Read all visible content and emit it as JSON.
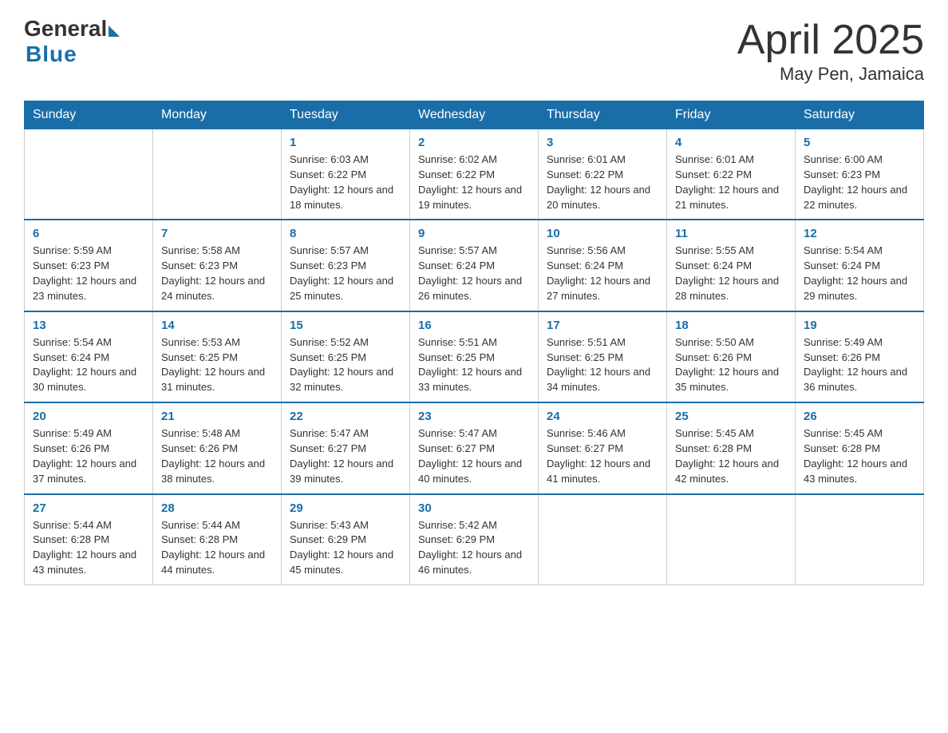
{
  "logo": {
    "general": "General",
    "blue": "Blue"
  },
  "header": {
    "month": "April 2025",
    "location": "May Pen, Jamaica"
  },
  "days_of_week": [
    "Sunday",
    "Monday",
    "Tuesday",
    "Wednesday",
    "Thursday",
    "Friday",
    "Saturday"
  ],
  "weeks": [
    [
      {
        "day": "",
        "sunrise": "",
        "sunset": "",
        "daylight": ""
      },
      {
        "day": "",
        "sunrise": "",
        "sunset": "",
        "daylight": ""
      },
      {
        "day": "1",
        "sunrise": "Sunrise: 6:03 AM",
        "sunset": "Sunset: 6:22 PM",
        "daylight": "Daylight: 12 hours and 18 minutes."
      },
      {
        "day": "2",
        "sunrise": "Sunrise: 6:02 AM",
        "sunset": "Sunset: 6:22 PM",
        "daylight": "Daylight: 12 hours and 19 minutes."
      },
      {
        "day": "3",
        "sunrise": "Sunrise: 6:01 AM",
        "sunset": "Sunset: 6:22 PM",
        "daylight": "Daylight: 12 hours and 20 minutes."
      },
      {
        "day": "4",
        "sunrise": "Sunrise: 6:01 AM",
        "sunset": "Sunset: 6:22 PM",
        "daylight": "Daylight: 12 hours and 21 minutes."
      },
      {
        "day": "5",
        "sunrise": "Sunrise: 6:00 AM",
        "sunset": "Sunset: 6:23 PM",
        "daylight": "Daylight: 12 hours and 22 minutes."
      }
    ],
    [
      {
        "day": "6",
        "sunrise": "Sunrise: 5:59 AM",
        "sunset": "Sunset: 6:23 PM",
        "daylight": "Daylight: 12 hours and 23 minutes."
      },
      {
        "day": "7",
        "sunrise": "Sunrise: 5:58 AM",
        "sunset": "Sunset: 6:23 PM",
        "daylight": "Daylight: 12 hours and 24 minutes."
      },
      {
        "day": "8",
        "sunrise": "Sunrise: 5:57 AM",
        "sunset": "Sunset: 6:23 PM",
        "daylight": "Daylight: 12 hours and 25 minutes."
      },
      {
        "day": "9",
        "sunrise": "Sunrise: 5:57 AM",
        "sunset": "Sunset: 6:24 PM",
        "daylight": "Daylight: 12 hours and 26 minutes."
      },
      {
        "day": "10",
        "sunrise": "Sunrise: 5:56 AM",
        "sunset": "Sunset: 6:24 PM",
        "daylight": "Daylight: 12 hours and 27 minutes."
      },
      {
        "day": "11",
        "sunrise": "Sunrise: 5:55 AM",
        "sunset": "Sunset: 6:24 PM",
        "daylight": "Daylight: 12 hours and 28 minutes."
      },
      {
        "day": "12",
        "sunrise": "Sunrise: 5:54 AM",
        "sunset": "Sunset: 6:24 PM",
        "daylight": "Daylight: 12 hours and 29 minutes."
      }
    ],
    [
      {
        "day": "13",
        "sunrise": "Sunrise: 5:54 AM",
        "sunset": "Sunset: 6:24 PM",
        "daylight": "Daylight: 12 hours and 30 minutes."
      },
      {
        "day": "14",
        "sunrise": "Sunrise: 5:53 AM",
        "sunset": "Sunset: 6:25 PM",
        "daylight": "Daylight: 12 hours and 31 minutes."
      },
      {
        "day": "15",
        "sunrise": "Sunrise: 5:52 AM",
        "sunset": "Sunset: 6:25 PM",
        "daylight": "Daylight: 12 hours and 32 minutes."
      },
      {
        "day": "16",
        "sunrise": "Sunrise: 5:51 AM",
        "sunset": "Sunset: 6:25 PM",
        "daylight": "Daylight: 12 hours and 33 minutes."
      },
      {
        "day": "17",
        "sunrise": "Sunrise: 5:51 AM",
        "sunset": "Sunset: 6:25 PM",
        "daylight": "Daylight: 12 hours and 34 minutes."
      },
      {
        "day": "18",
        "sunrise": "Sunrise: 5:50 AM",
        "sunset": "Sunset: 6:26 PM",
        "daylight": "Daylight: 12 hours and 35 minutes."
      },
      {
        "day": "19",
        "sunrise": "Sunrise: 5:49 AM",
        "sunset": "Sunset: 6:26 PM",
        "daylight": "Daylight: 12 hours and 36 minutes."
      }
    ],
    [
      {
        "day": "20",
        "sunrise": "Sunrise: 5:49 AM",
        "sunset": "Sunset: 6:26 PM",
        "daylight": "Daylight: 12 hours and 37 minutes."
      },
      {
        "day": "21",
        "sunrise": "Sunrise: 5:48 AM",
        "sunset": "Sunset: 6:26 PM",
        "daylight": "Daylight: 12 hours and 38 minutes."
      },
      {
        "day": "22",
        "sunrise": "Sunrise: 5:47 AM",
        "sunset": "Sunset: 6:27 PM",
        "daylight": "Daylight: 12 hours and 39 minutes."
      },
      {
        "day": "23",
        "sunrise": "Sunrise: 5:47 AM",
        "sunset": "Sunset: 6:27 PM",
        "daylight": "Daylight: 12 hours and 40 minutes."
      },
      {
        "day": "24",
        "sunrise": "Sunrise: 5:46 AM",
        "sunset": "Sunset: 6:27 PM",
        "daylight": "Daylight: 12 hours and 41 minutes."
      },
      {
        "day": "25",
        "sunrise": "Sunrise: 5:45 AM",
        "sunset": "Sunset: 6:28 PM",
        "daylight": "Daylight: 12 hours and 42 minutes."
      },
      {
        "day": "26",
        "sunrise": "Sunrise: 5:45 AM",
        "sunset": "Sunset: 6:28 PM",
        "daylight": "Daylight: 12 hours and 43 minutes."
      }
    ],
    [
      {
        "day": "27",
        "sunrise": "Sunrise: 5:44 AM",
        "sunset": "Sunset: 6:28 PM",
        "daylight": "Daylight: 12 hours and 43 minutes."
      },
      {
        "day": "28",
        "sunrise": "Sunrise: 5:44 AM",
        "sunset": "Sunset: 6:28 PM",
        "daylight": "Daylight: 12 hours and 44 minutes."
      },
      {
        "day": "29",
        "sunrise": "Sunrise: 5:43 AM",
        "sunset": "Sunset: 6:29 PM",
        "daylight": "Daylight: 12 hours and 45 minutes."
      },
      {
        "day": "30",
        "sunrise": "Sunrise: 5:42 AM",
        "sunset": "Sunset: 6:29 PM",
        "daylight": "Daylight: 12 hours and 46 minutes."
      },
      {
        "day": "",
        "sunrise": "",
        "sunset": "",
        "daylight": ""
      },
      {
        "day": "",
        "sunrise": "",
        "sunset": "",
        "daylight": ""
      },
      {
        "day": "",
        "sunrise": "",
        "sunset": "",
        "daylight": ""
      }
    ]
  ]
}
